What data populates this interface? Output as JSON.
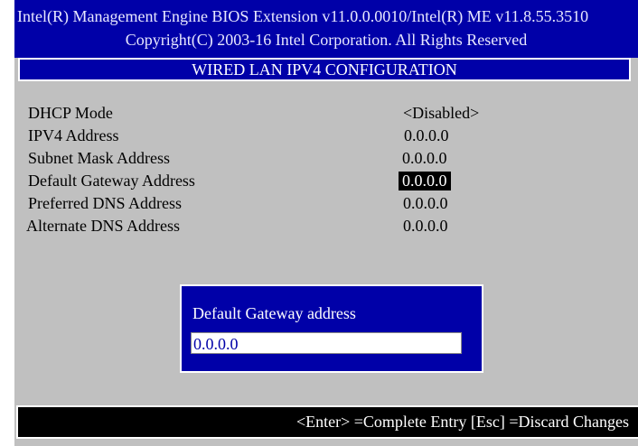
{
  "header": {
    "line1": "Intel(R) Management Engine BIOS Extension v11.0.0.0010/Intel(R) ME v11.8.55.3510",
    "line2": "Copyright(C) 2003-16 Intel Corporation. All Rights Reserved"
  },
  "title": "WIRED LAN IPV4 CONFIGURATION",
  "settings": [
    {
      "label": "DHCP Mode",
      "value": "<Disabled>"
    },
    {
      "label": "IPV4 Address",
      "value": "0.0.0.0"
    },
    {
      "label": "Subnet Mask Address",
      "value": "0.0.0.0"
    },
    {
      "label": "Default Gateway Address",
      "value": "0.0.0.0"
    },
    {
      "label": "Preferred DNS Address",
      "value": "0.0.0.0"
    },
    {
      "label": "Alternate DNS Address",
      "value": "0.0.0.0"
    }
  ],
  "dialog": {
    "label": "Default Gateway address",
    "value": "0.0.0.0"
  },
  "footer": {
    "hint": "<Enter> =Complete Entry  [Esc] =Discard Changes"
  },
  "colors": {
    "background": "#c0c0c0",
    "header_blue": "#0000a8",
    "highlight": "#000000"
  }
}
